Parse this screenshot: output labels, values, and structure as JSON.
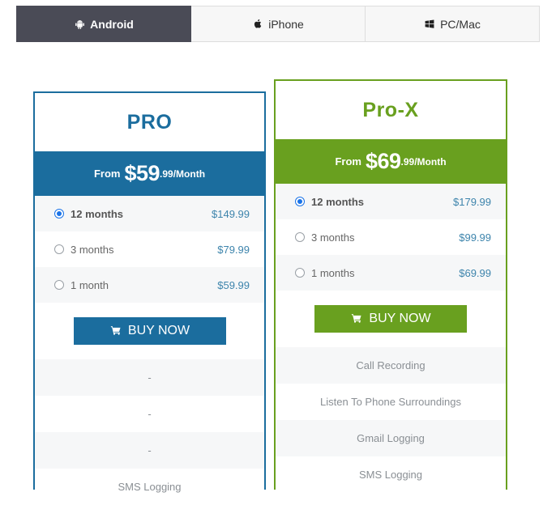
{
  "tabs": [
    {
      "label": "Android",
      "icon": "android-icon",
      "active": true
    },
    {
      "label": "iPhone",
      "icon": "apple-icon",
      "active": false
    },
    {
      "label": "PC/Mac",
      "icon": "windows-icon",
      "active": false
    }
  ],
  "colors": {
    "pro_accent": "#1b6d9e",
    "prox_accent": "#69a01f",
    "active_tab_bg": "#4a4b56",
    "row_shaded_bg": "#f6f7f8",
    "price_text": "#3d84ac",
    "radio_checked": "#1a73e8"
  },
  "plans": [
    {
      "title": "PRO",
      "price_from": "From",
      "price_main": "$59",
      "price_suffix": ".99/Month",
      "options": [
        {
          "label": "12 months",
          "price": "$149.99",
          "selected": true
        },
        {
          "label": "3 months",
          "price": "$79.99",
          "selected": false
        },
        {
          "label": "1 month",
          "price": "$59.99",
          "selected": false
        }
      ],
      "buy_label": "BUY NOW",
      "features": [
        "-",
        "-",
        "-",
        "SMS Logging"
      ]
    },
    {
      "title": "Pro-X",
      "price_from": "From",
      "price_main": "$69",
      "price_suffix": ".99/Month",
      "options": [
        {
          "label": "12 months",
          "price": "$179.99",
          "selected": true
        },
        {
          "label": "3 months",
          "price": "$99.99",
          "selected": false
        },
        {
          "label": "1 months",
          "price": "$69.99",
          "selected": false
        }
      ],
      "buy_label": "BUY NOW",
      "features": [
        "Call Recording",
        "Listen To Phone Surroundings",
        "Gmail Logging",
        "SMS Logging"
      ]
    }
  ]
}
